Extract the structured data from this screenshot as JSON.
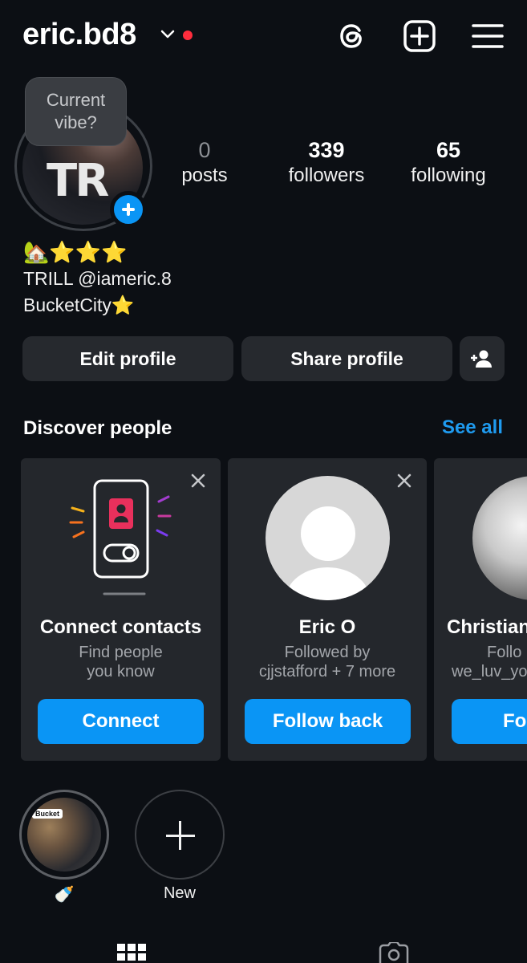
{
  "header": {
    "username": "eric.bd8",
    "icons": [
      "chevron-down-icon",
      "notification-dot",
      "threads-icon",
      "create-plus-icon",
      "menu-icon"
    ]
  },
  "profile": {
    "note_bubble": "Current vibe?",
    "stats": [
      {
        "value": "0",
        "label": "posts"
      },
      {
        "value": "339",
        "label": "followers"
      },
      {
        "value": "65",
        "label": "following"
      }
    ],
    "bio": {
      "line1": "🏡⭐⭐⭐",
      "line2": "TRILL @iameric.8",
      "line3": "BucketCity⭐"
    }
  },
  "actions": {
    "edit_profile": "Edit profile",
    "share_profile": "Share profile"
  },
  "discover": {
    "title": "Discover people",
    "see_all": "See all",
    "cards": [
      {
        "name": "Connect contacts",
        "sub1": "Find people",
        "sub2": "you know",
        "button": "Connect"
      },
      {
        "name": "Eric O",
        "sub1": "Followed by",
        "sub2": "cjjstafford + 7 more",
        "button": "Follow back"
      },
      {
        "name": "Christian",
        "sub1": "Follo",
        "sub2": "we_luv_yo",
        "button": "Fo"
      }
    ]
  },
  "highlights": [
    {
      "label": "🍼",
      "inner_tag": "Bucket"
    },
    {
      "label": "New"
    }
  ],
  "colors": {
    "background": "#0c0f14",
    "accent": "#0a95f5",
    "link": "#1f9bf0",
    "card": "#24272c",
    "button": "#26292e",
    "notification": "#ff2d3d"
  }
}
